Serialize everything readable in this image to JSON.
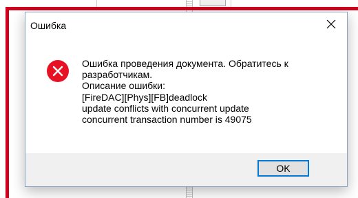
{
  "dialog": {
    "title": "Ошибка",
    "icon": "error-icon",
    "message_lines": [
      "Ошибка проведения документа. Обратитесь к",
      "разработчикам.",
      "Описание ошибки:",
      "[FireDAC][Phys][FB]deadlock",
      "update conflicts with concurrent update",
      "concurrent transaction number is 49075"
    ],
    "ok_label": "OK"
  },
  "colors": {
    "highlight_frame": "#d0021b",
    "error_icon": "#e81123",
    "button_border": "#0078d7",
    "footer": "#f0f0f0"
  }
}
